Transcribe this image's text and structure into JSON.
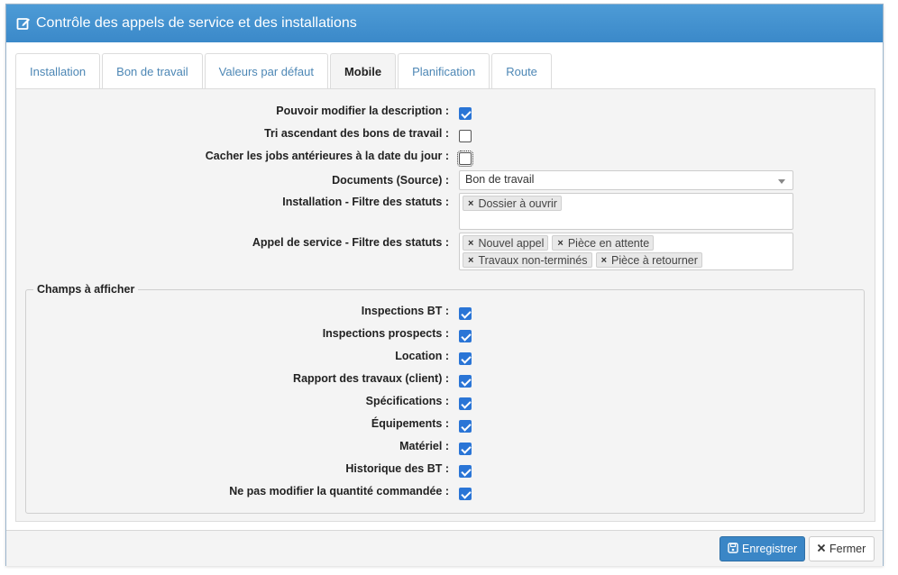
{
  "window": {
    "title": "Contrôle des appels de service et des installations",
    "icon": "edit-icon"
  },
  "tabs": [
    {
      "label": "Installation",
      "active": false
    },
    {
      "label": "Bon de travail",
      "active": false
    },
    {
      "label": "Valeurs par défaut",
      "active": false
    },
    {
      "label": "Mobile",
      "active": true
    },
    {
      "label": "Planification",
      "active": false
    },
    {
      "label": "Route",
      "active": false
    }
  ],
  "mobile": {
    "edit_description": {
      "label": "Pouvoir modifier la description :",
      "checked": true
    },
    "sort_ascending": {
      "label": "Tri ascendant des bons de travail :",
      "checked": false
    },
    "hide_past_jobs": {
      "label": "Cacher les jobs antérieures à la date du jour :",
      "checked": false
    },
    "documents_source": {
      "label": "Documents (Source) :",
      "value": "Bon de travail"
    },
    "installation_filter": {
      "label": "Installation - Filtre des statuts :",
      "tags": [
        "Dossier à ouvrir"
      ]
    },
    "service_call_filter": {
      "label": "Appel de service - Filtre des statuts :",
      "tags": [
        "Nouvel appel",
        "Pièce en attente",
        "Travaux non-terminés",
        "Pièce à retourner"
      ]
    }
  },
  "fields_section": {
    "legend": "Champs à afficher",
    "items": [
      {
        "label": "Inspections BT :",
        "checked": true
      },
      {
        "label": "Inspections prospects :",
        "checked": true
      },
      {
        "label": "Location :",
        "checked": true
      },
      {
        "label": "Rapport des travaux (client) :",
        "checked": true
      },
      {
        "label": "Spécifications :",
        "checked": true
      },
      {
        "label": "Équipements :",
        "checked": true
      },
      {
        "label": "Matériel :",
        "checked": true
      },
      {
        "label": "Historique des BT :",
        "checked": true
      },
      {
        "label": "Ne pas modifier la quantité commandée :",
        "checked": true
      }
    ]
  },
  "footer": {
    "save_label": "Enregistrer",
    "close_label": "Fermer"
  },
  "colors": {
    "header": "#3b89c9",
    "primary_button": "#3a86c6",
    "checkbox_checked": "#2a75d6",
    "tab_link": "#4d87b5"
  }
}
